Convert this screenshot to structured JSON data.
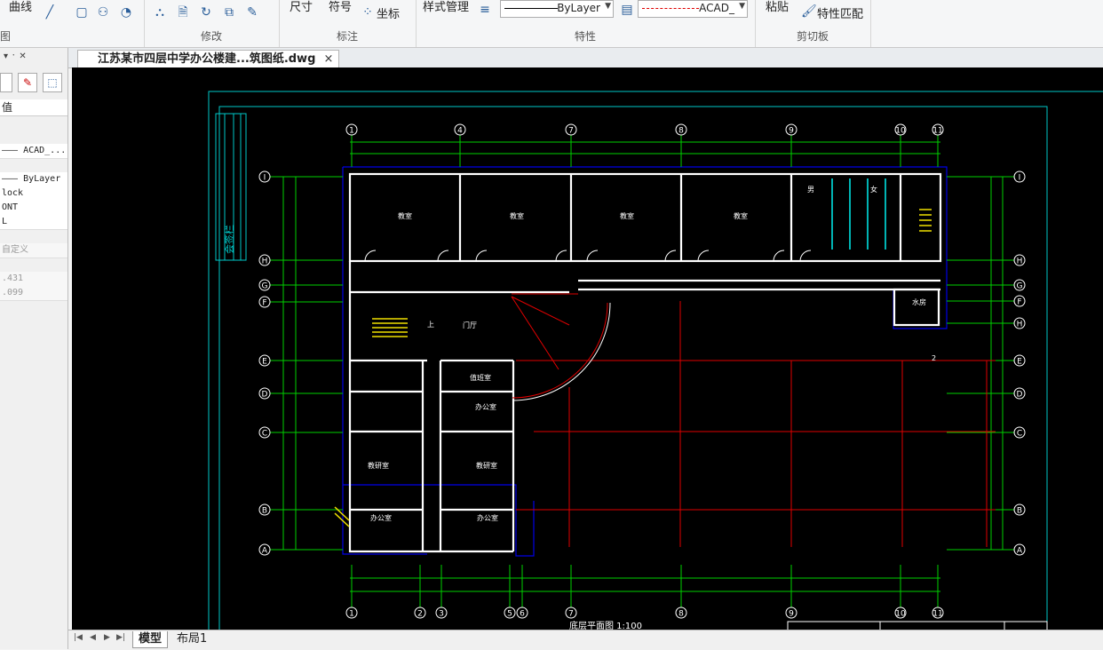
{
  "ribbon": {
    "draw": {
      "curve_label": "曲线",
      "group_title": "图"
    },
    "modify": {
      "group_title": "修改"
    },
    "annotate": {
      "dimension_label": "尺寸",
      "symbol_label": "符号",
      "coord_label": "坐标",
      "group_title": "标注"
    },
    "properties": {
      "style_label": "样式管理",
      "linetype_value": "ByLayer",
      "layer_linetype_value": "ACAD_",
      "group_title": "特性",
      "red_line_color": "#e00000"
    },
    "clipboard": {
      "paste_label": "粘贴",
      "match_label": "特性匹配",
      "group_title": "剪切板"
    }
  },
  "panel": {
    "pin_glyph": "▾ ᛫ ✕",
    "header": "值",
    "rows": [
      "——— ACAD_...",
      "——— ByLayer",
      "lock",
      "ONT",
      "L",
      "自定义",
      ".431",
      ".099"
    ]
  },
  "tab": {
    "doc_title": "江苏某市四层中学办公楼建...筑图纸.dwg",
    "close": "×"
  },
  "layouts": {
    "model": "模型",
    "layout1": "布局1"
  },
  "drawing": {
    "title_label": "底层平面图 1:100",
    "sign_column_label": "会签栏",
    "top_axes": [
      "1",
      "4",
      "7",
      "8",
      "9",
      "10",
      "11"
    ],
    "bottom_axes": [
      "1",
      "2",
      "3",
      "5",
      "6",
      "7",
      "8",
      "9",
      "10",
      "11"
    ],
    "left_axes": [
      "I",
      "H",
      "G",
      "F",
      "E",
      "D",
      "C",
      "B",
      "A"
    ],
    "right_axes": [
      "I",
      "H",
      "G",
      "F",
      "H",
      "E",
      "D",
      "C",
      "B",
      "A"
    ],
    "rooms": {
      "classroom": "教室",
      "hall": "门厅",
      "duty": "值班室",
      "office": "办公室",
      "research": "教研室",
      "water": "水房",
      "wc_men": "男",
      "wc_women": "女",
      "up_label": "上",
      "section_label": "2"
    },
    "colors": {
      "background": "#000000",
      "frame": "#00c8c8",
      "grid": "#00d000",
      "wall": "#ffffff",
      "red": "#e00000",
      "blue": "#0000e6",
      "yellow": "#f0e000"
    }
  }
}
